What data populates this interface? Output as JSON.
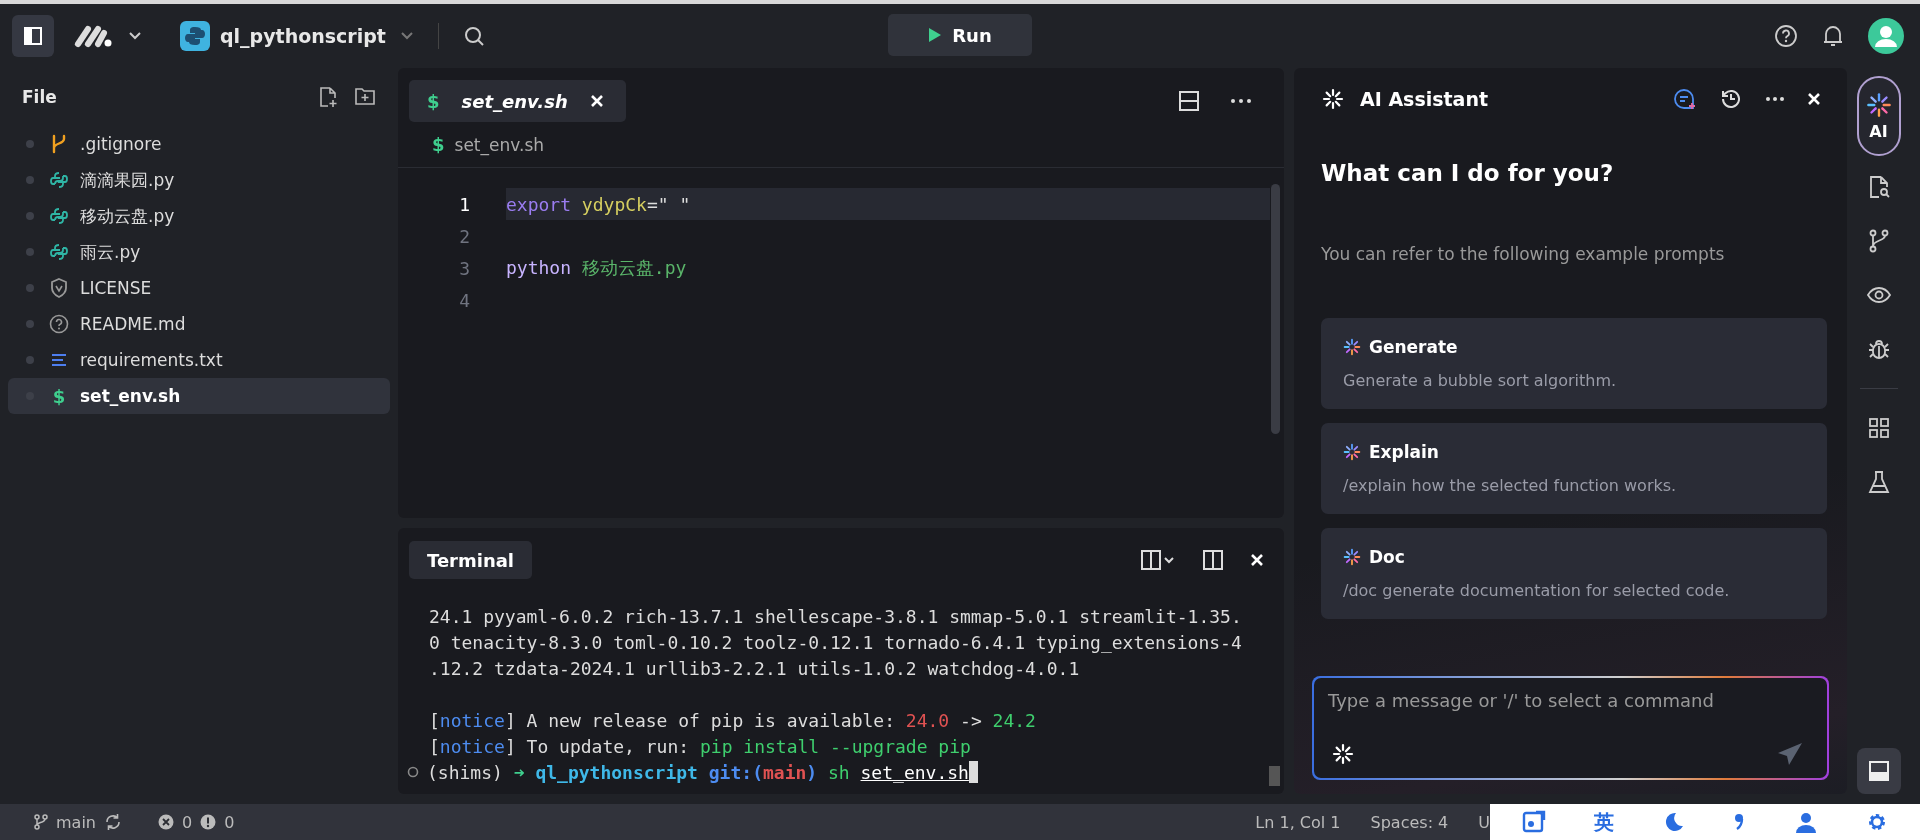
{
  "top_bar": {
    "project": "ql_pythonscript",
    "run_button": "Run"
  },
  "explorer": {
    "title": "File",
    "files": [
      {
        "name": ".gitignore",
        "kind": "git",
        "selected": false
      },
      {
        "name": "滴滴果园.py",
        "kind": "python",
        "selected": false
      },
      {
        "name": "移动云盘.py",
        "kind": "python",
        "selected": false
      },
      {
        "name": "雨云.py",
        "kind": "python",
        "selected": false
      },
      {
        "name": "LICENSE",
        "kind": "license",
        "selected": false
      },
      {
        "name": "README.md",
        "kind": "readme",
        "selected": false
      },
      {
        "name": "requirements.txt",
        "kind": "text",
        "selected": false
      },
      {
        "name": "set_env.sh",
        "kind": "shell",
        "glyph": "$",
        "selected": true
      }
    ]
  },
  "editor": {
    "tabs": [
      {
        "label": "set_env.sh",
        "glyph": "$",
        "selected": true
      }
    ],
    "breadcrumb": {
      "glyph": "$",
      "label": "set_env.sh"
    },
    "lines": [
      {
        "number": "1",
        "current": true,
        "tokens": [
          {
            "text": "export",
            "kind": "keyword"
          },
          {
            "text": " ydypCk",
            "kind": "variable"
          },
          {
            "text": "=\" \"",
            "kind": "plain"
          }
        ]
      },
      {
        "number": "2",
        "current": false
      },
      {
        "number": "3",
        "current": false,
        "tokens": [
          {
            "text": "python",
            "kind": "keyword2"
          },
          {
            "text": " 移动云盘.py",
            "kind": "string"
          }
        ]
      },
      {
        "number": "4",
        "current": false
      }
    ]
  },
  "terminal": {
    "title": "Terminal",
    "output": [
      "24.1 pyyaml-6.0.2 rich-13.7.1 shellescape-3.8.1 smmap-5.0.1 streamlit-1.35.",
      "0 tenacity-8.3.0 toml-0.10.2 toolz-0.12.1 tornado-6.4.1 typing_extensions-4",
      ".12.2 tzdata-2024.1 urllib3-2.2.1 utils-1.0.2 watchdog-4.0.1"
    ],
    "notices": [
      [
        {
          "text": "[",
          "kind": "plain"
        },
        {
          "text": "notice",
          "kind": "info"
        },
        {
          "text": "] A new release of pip is available: ",
          "kind": "plain"
        },
        {
          "text": "24.0",
          "kind": "old"
        },
        {
          "text": " -> ",
          "kind": "plain"
        },
        {
          "text": "24.2",
          "kind": "new"
        }
      ],
      [
        {
          "text": "[",
          "kind": "plain"
        },
        {
          "text": "notice",
          "kind": "info"
        },
        {
          "text": "] To update, run: ",
          "kind": "plain"
        },
        {
          "text": "pip install --upgrade pip",
          "kind": "new"
        }
      ]
    ],
    "prompt": [
      {
        "text": "(shims) ",
        "kind": "plain"
      },
      {
        "text": "➜ ",
        "kind": "arrow"
      },
      {
        "text": "ql_pythonscript ",
        "kind": "path"
      },
      {
        "text": "git:(",
        "kind": "git"
      },
      {
        "text": "main",
        "kind": "branch"
      },
      {
        "text": ")",
        "kind": "git"
      },
      {
        "text": " sh ",
        "kind": "command"
      },
      {
        "text": "set_env.sh",
        "kind": "argument"
      }
    ]
  },
  "ai_assistant": {
    "title": "AI Assistant",
    "heading": "What can I do for you?",
    "subtitle": "You can refer to the following example prompts",
    "prompts": [
      {
        "title": "Generate",
        "text": "Generate a bubble sort algorithm."
      },
      {
        "title": "Explain",
        "text": "/explain how the selected function works."
      },
      {
        "title": "Doc",
        "text": "/doc generate documentation for selected code."
      }
    ],
    "input": {
      "placeholder": "Type a message or '/' to select a command"
    }
  },
  "right_rail": {
    "items": [
      {
        "kind": "ai",
        "label": "AI",
        "selected": true
      },
      {
        "kind": "search-file",
        "selected": false
      },
      {
        "kind": "branch",
        "selected": false
      },
      {
        "kind": "eye",
        "selected": false
      },
      {
        "kind": "bug",
        "selected": false
      },
      {
        "kind": "grid",
        "selected": false
      },
      {
        "kind": "flask",
        "selected": false
      }
    ],
    "panel_toggle": {
      "selected": true
    }
  },
  "status_bar": {
    "branch": "main",
    "errors": "0",
    "warnings": "0",
    "position": "Ln 1, Col 1",
    "spaces": "Spaces: 4",
    "encoding": "U"
  },
  "ime_toolbar": {
    "mode": "英"
  }
}
